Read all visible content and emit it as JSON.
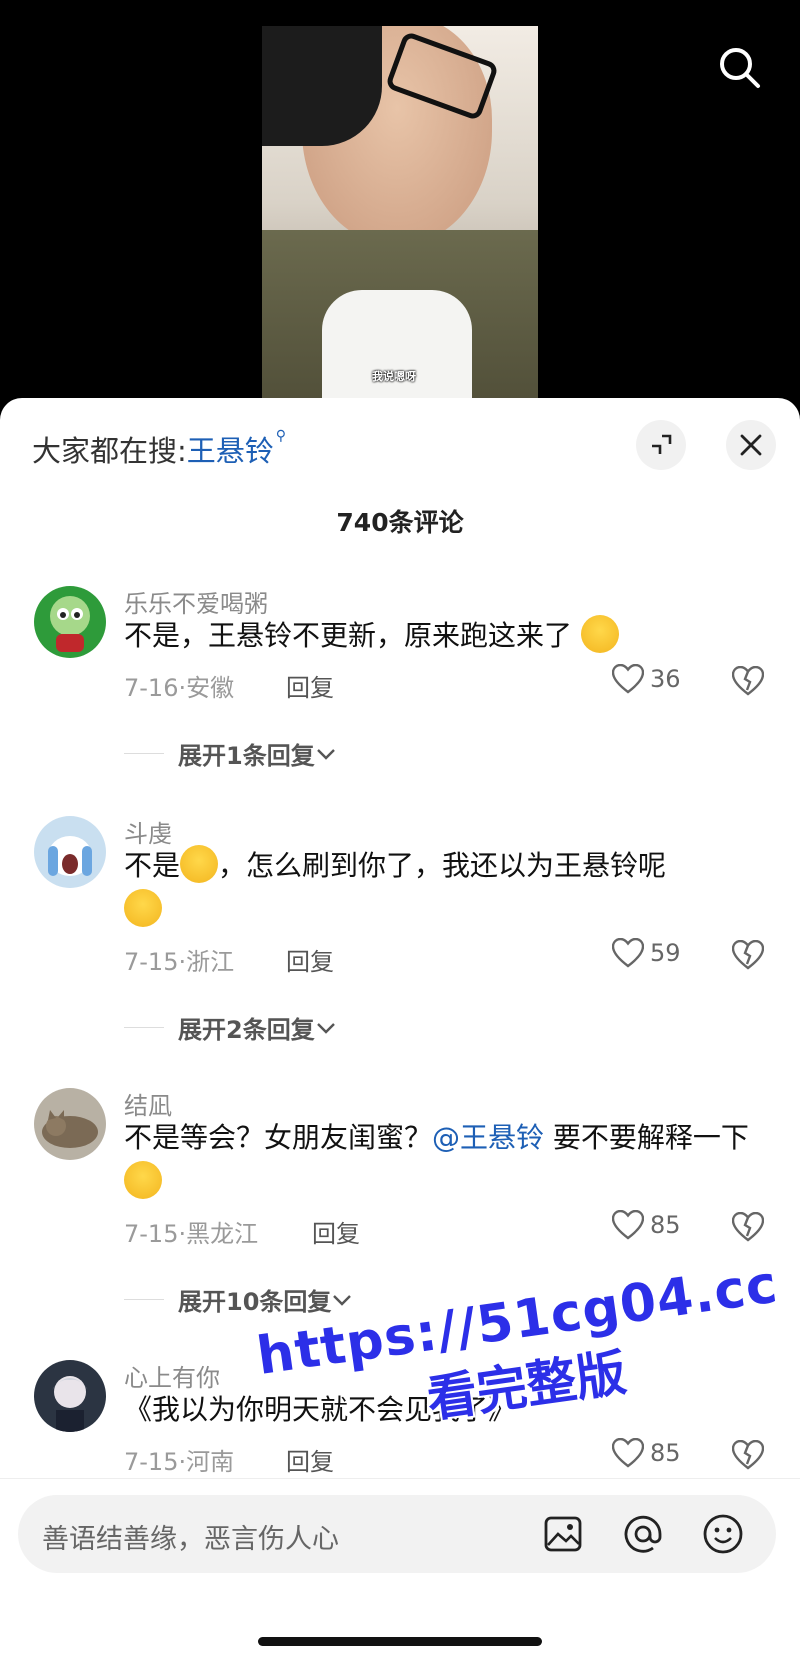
{
  "video": {
    "caption": "我说嗯呀"
  },
  "header": {
    "trending_prefix": "大家都在搜:",
    "trending_keyword": "王悬铃",
    "comment_count": "740条评论"
  },
  "comments": [
    {
      "username": "乐乐不爱喝粥",
      "text": "不是，王悬铃不更新，原来跑这来了",
      "date_loc": "7-16·安徽",
      "reply": "回复",
      "likes": "36",
      "expand": "展开1条回复"
    },
    {
      "username": "斗虔",
      "text_a": "不是",
      "text_b": "，怎么刷到你了，我还以为王悬铃呢",
      "date_loc": "7-15·浙江",
      "reply": "回复",
      "likes": "59",
      "expand": "展开2条回复"
    },
    {
      "username": "结凪",
      "text_a": "不是等会？女朋友闺蜜？",
      "mention": "@王悬铃",
      "text_b": " 要不要解释一下",
      "date_loc": "7-15·黑龙江",
      "reply": "回复",
      "likes": "85",
      "expand": "展开10条回复"
    },
    {
      "username": "心上有你",
      "text": "《我以为你明天就不会见我了》",
      "date_loc": "7-15·河南",
      "reply": "回复",
      "likes": "85"
    }
  ],
  "input": {
    "placeholder": "善语结善缘，恶言伤人心"
  },
  "watermark": {
    "line1": "https://51cg04.cc",
    "line2": "看完整版"
  },
  "icons": [
    "search-icon",
    "collapse-icon",
    "close-icon",
    "heart-icon",
    "broken-heart-icon",
    "chevron-down-icon",
    "image-icon",
    "at-icon",
    "emoji-icon"
  ]
}
